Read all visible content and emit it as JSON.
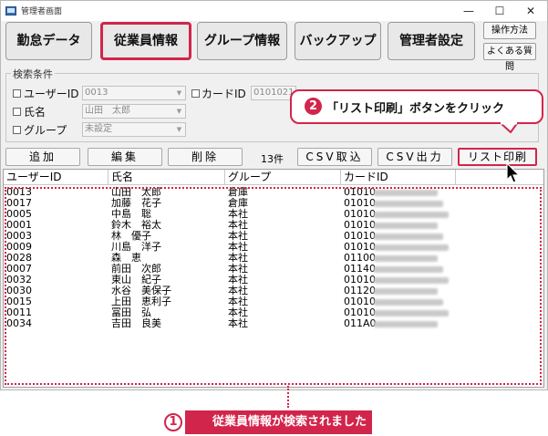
{
  "window": {
    "title": "管理者画面",
    "minimize_glyph": "—",
    "maximize_glyph": "☐",
    "close_glyph": "✕"
  },
  "tabs": [
    {
      "label": "勤怠データ",
      "active": false
    },
    {
      "label": "従業員情報",
      "active": true
    },
    {
      "label": "グループ情報",
      "active": false
    },
    {
      "label": "バックアップ",
      "active": false
    },
    {
      "label": "管理者設定",
      "active": false
    }
  ],
  "side_buttons": {
    "manual": "操作方法",
    "faq": "よくある質問"
  },
  "search": {
    "group_title": "検索条件",
    "user_id_label": "ユーザーID",
    "user_id_value": "0013",
    "card_id_label": "カードID",
    "card_id_value": "0101021",
    "name_label": "氏名",
    "name_value": "山田　太郎",
    "group_label": "グループ",
    "group_value": "未設定"
  },
  "actions": {
    "add": "追加",
    "edit": "編集",
    "delete": "削除",
    "count": "13件",
    "csv_import": "CSV取込",
    "csv_export": "CSV出力",
    "list_print": "リスト印刷"
  },
  "table": {
    "columns": [
      "ユーザーID",
      "氏名",
      "グループ",
      "カードID"
    ],
    "rows": [
      {
        "id": "0013",
        "name": "山田　太郎",
        "group": "倉庫",
        "card": "01010"
      },
      {
        "id": "0017",
        "name": "加藤　花子",
        "group": "倉庫",
        "card": "01010"
      },
      {
        "id": "0005",
        "name": "中島　聡",
        "group": "本社",
        "card": "01010"
      },
      {
        "id": "0001",
        "name": "鈴木　裕太",
        "group": "本社",
        "card": "01010"
      },
      {
        "id": "0003",
        "name": "林　優子",
        "group": "本社",
        "card": "01010"
      },
      {
        "id": "0009",
        "name": "川島　洋子",
        "group": "本社",
        "card": "01010"
      },
      {
        "id": "0028",
        "name": "森　恵",
        "group": "本社",
        "card": "01100"
      },
      {
        "id": "0007",
        "name": "前田　次郎",
        "group": "本社",
        "card": "01140"
      },
      {
        "id": "0032",
        "name": "東山　紀子",
        "group": "本社",
        "card": "01010"
      },
      {
        "id": "0030",
        "name": "水谷　美保子",
        "group": "本社",
        "card": "01120"
      },
      {
        "id": "0015",
        "name": "上田　恵利子",
        "group": "本社",
        "card": "01010"
      },
      {
        "id": "0011",
        "name": "冨田　弘",
        "group": "本社",
        "card": "01010"
      },
      {
        "id": "0034",
        "name": "吉田　良美",
        "group": "本社",
        "card": "011A0"
      }
    ]
  },
  "annotations": {
    "step1_number": "1",
    "step1_text": "従業員情報が検索されました",
    "step2_number": "2",
    "step2_text": "「リスト印刷」ボタンをクリック"
  },
  "colors": {
    "highlight": "#d2254b",
    "window_bg": "#f0f0f0"
  }
}
